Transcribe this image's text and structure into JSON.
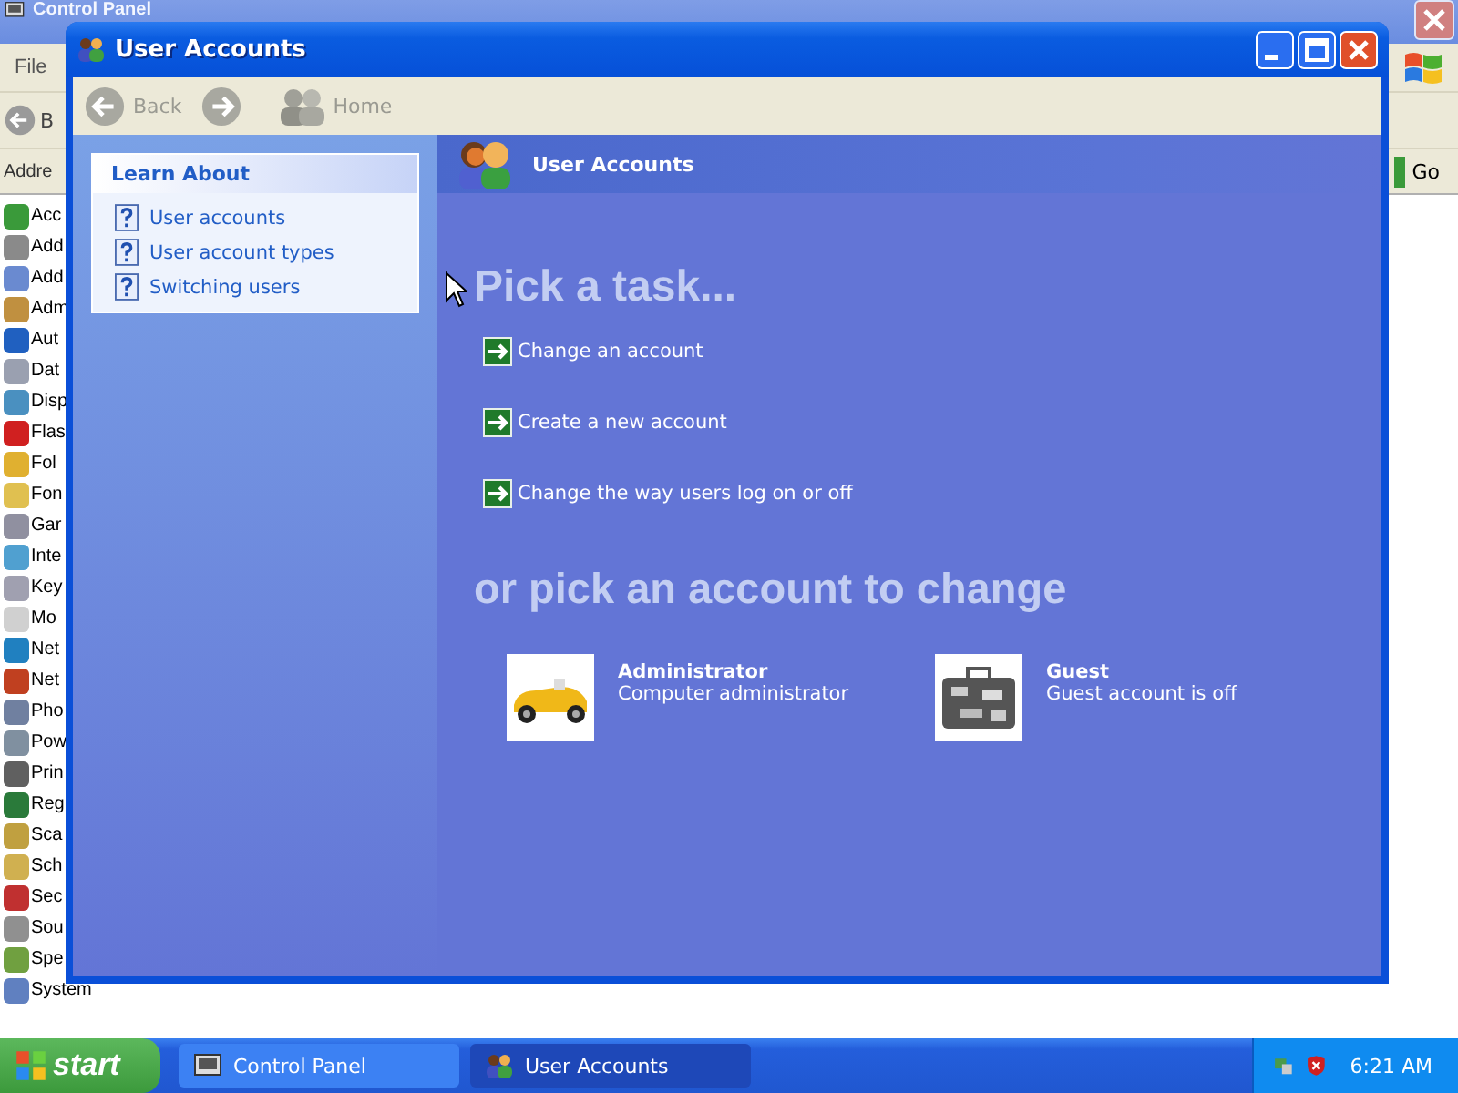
{
  "background_window": {
    "title": "Control Panel",
    "menu": [
      "File"
    ],
    "toolbar": [
      "B"
    ],
    "address_label": "Addre",
    "go_button": "Go",
    "items": [
      "Acc",
      "Add",
      "Add",
      "Adm",
      "Aut",
      "Dat",
      "Disp",
      "Flas",
      "Fol",
      "Fon",
      "Gar",
      "Inte",
      "Key",
      "Mo",
      "Net",
      "Net",
      "Pho",
      "Pow",
      "Prin",
      "Reg",
      "Sca",
      "Sch",
      "Sec",
      "Sou",
      "Spe",
      "System"
    ]
  },
  "window": {
    "title": "User Accounts",
    "nav": [
      {
        "kind": "back",
        "label": "Back",
        "disabled": true
      },
      {
        "kind": "forward",
        "disabled": true
      },
      {
        "kind": "home",
        "label": "Home",
        "disabled": true
      }
    ],
    "learn_about": {
      "title": "Learn About",
      "items": [
        "User accounts",
        "User account types",
        "Switching users"
      ]
    },
    "header": "User Accounts",
    "task_heading": "Pick a task...",
    "tasks": [
      "Change an account",
      "Create a new account",
      "Change the way users log on or off"
    ],
    "account_heading": "or pick an account to change",
    "accounts": [
      {
        "name": "Administrator",
        "type": "Computer administrator",
        "kind": "car"
      },
      {
        "name": "Guest",
        "type": "Guest account is off",
        "kind": "suitcase"
      }
    ]
  },
  "taskbar": {
    "start": "start",
    "tasks": [
      {
        "label": "Control Panel",
        "selected": false
      },
      {
        "label": "User Accounts",
        "selected": true
      }
    ],
    "clock": "6:21 AM"
  }
}
